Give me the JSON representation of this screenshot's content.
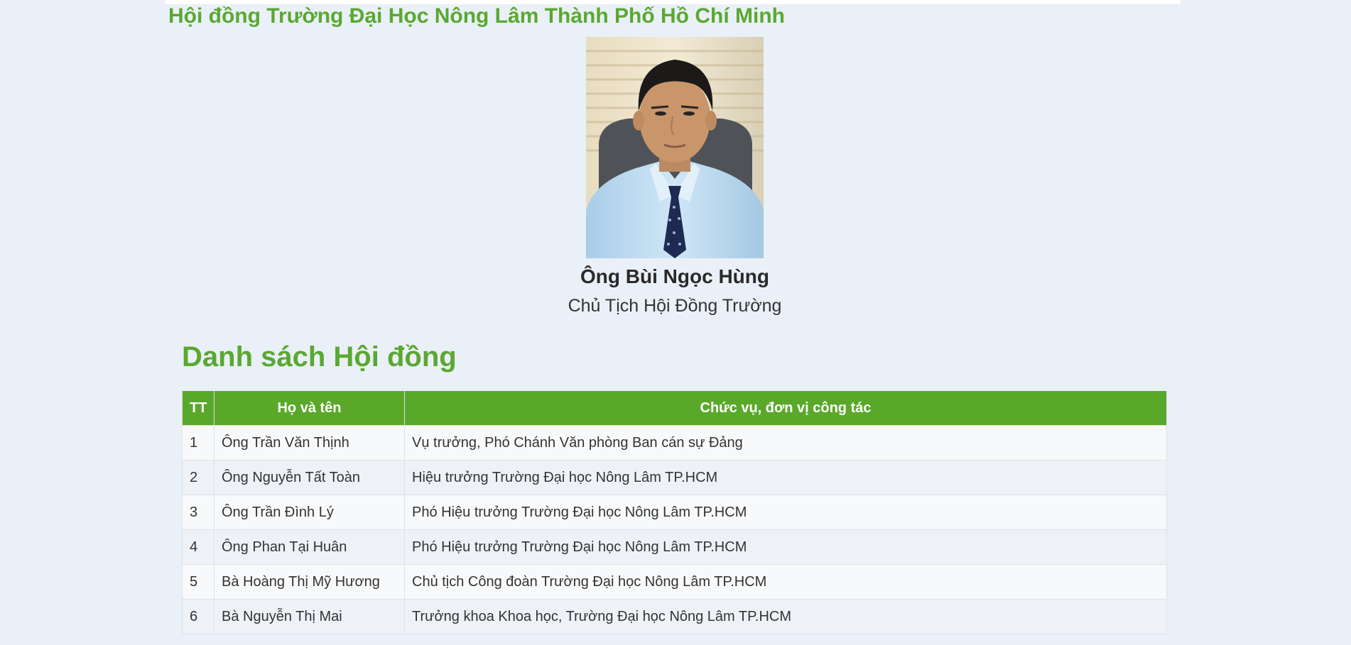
{
  "page": {
    "heading": "Hội đồng Trường Đại Học Nông Lâm Thành Phố Hồ Chí Minh"
  },
  "chair": {
    "name": "Ông Bùi Ngọc Hùng",
    "role": "Chủ Tịch Hội Đồng Trường"
  },
  "council": {
    "heading": "Danh sách Hội đồng",
    "columns": [
      "TT",
      "Họ và tên",
      "Chức vụ, đơn vị công tác"
    ],
    "rows": [
      {
        "tt": "1",
        "name": "Ông Trần Văn Thịnh",
        "position": "Vụ trưởng, Phó Chánh Văn phòng Ban cán sự Đảng"
      },
      {
        "tt": "2",
        "name": "Ông Nguyễn Tất Toàn",
        "position": "Hiệu trưởng Trường Đại học Nông Lâm TP.HCM"
      },
      {
        "tt": "3",
        "name": "Ông Trần Đình Lý",
        "position": "Phó Hiệu trưởng Trường Đại học Nông Lâm TP.HCM"
      },
      {
        "tt": "4",
        "name": "Ông Phan Tại Huân",
        "position": "Phó Hiệu trưởng Trường Đại học Nông Lâm TP.HCM"
      },
      {
        "tt": "5",
        "name": "Bà Hoàng Thị Mỹ Hương",
        "position": "Chủ tịch Công đoàn Trường Đại học Nông Lâm TP.HCM"
      },
      {
        "tt": "6",
        "name": "Bà Nguyễn Thị Mai",
        "position": "Trưởng khoa Khoa học, Trường Đại học Nông Lâm TP.HCM"
      }
    ]
  },
  "colors": {
    "accent": "#5aa832",
    "header_bg": "#5aa82a",
    "page_bg": "#eaf0f7"
  }
}
